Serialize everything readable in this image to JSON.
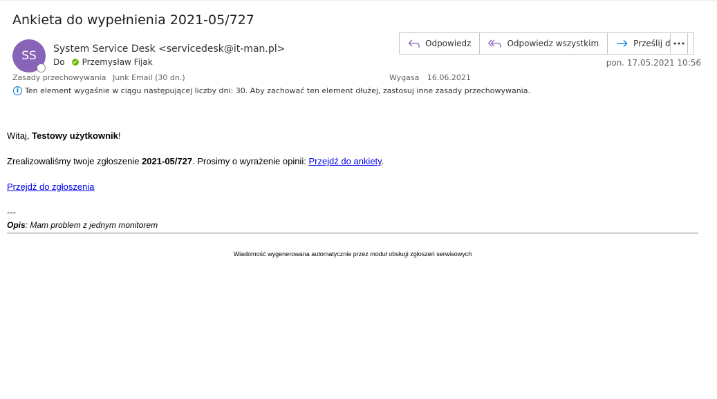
{
  "subject": "Ankieta do wypełnienia 2021-05/727",
  "avatar_initials": "SS",
  "sender": "System Service Desk <servicedesk@it-man.pl>",
  "to_label": "Do",
  "recipient": "Przemysław Fijak",
  "toolbar": {
    "reply": "Odpowiedz",
    "reply_all": "Odpowiedz wszystkim",
    "forward": "Prześlij dalej"
  },
  "date": "pon. 17.05.2021 10:56",
  "retention": {
    "label": "Zasady przechowywania",
    "value": "Junk Email (30 dn.)",
    "expires_label": "Wygasa",
    "expires_value": "16.06.2021",
    "info": "Ten element wygaśnie w ciągu następującej liczby dni: 30. Aby zachować ten element dłużej, zastosuj inne zasady przechowywania."
  },
  "body": {
    "greeting_prefix": "Witaj, ",
    "greeting_name": "Testowy użytkownik",
    "greeting_suffix": "!",
    "line2_prefix": "Zrealizowaliśmy twoje zgłoszenie ",
    "ticket_id": "2021-05/727",
    "line2_middle": ". Prosimy o wyrażenie opinii: ",
    "survey_link": "Przejdź do ankiety",
    "line2_suffix": ".",
    "ticket_link": "Przejdź do zgłoszenia",
    "separator": "---",
    "desc_label": "Opis",
    "desc_text": ": Mam problem z jednym monitorem"
  },
  "footer": "Wiadomość wygenerowana automatycznie przez moduł obsługi zgłoszeń serwisowych",
  "colors": {
    "avatar": "#8764b8",
    "accent": "#0078d4",
    "presence_ok": "#6bb700",
    "link": "#0000ee"
  }
}
